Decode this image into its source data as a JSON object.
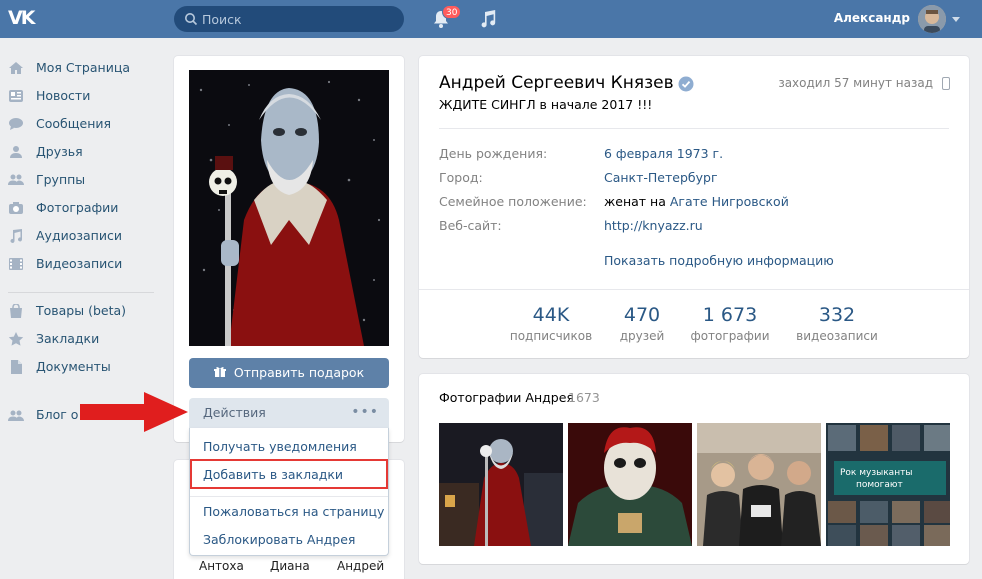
{
  "header": {
    "logo_text": "VK",
    "search_placeholder": "Поиск",
    "notifications_count": "30",
    "user_name": "Александр",
    "accent_color": "#4a76a8"
  },
  "sidebar": {
    "items": [
      {
        "label": "Моя Страница",
        "icon": "home-icon"
      },
      {
        "label": "Новости",
        "icon": "news-icon"
      },
      {
        "label": "Сообщения",
        "icon": "messages-icon"
      },
      {
        "label": "Друзья",
        "icon": "friends-icon"
      },
      {
        "label": "Группы",
        "icon": "groups-icon"
      },
      {
        "label": "Фотографии",
        "icon": "camera-icon"
      },
      {
        "label": "Аудиозаписи",
        "icon": "music-icon"
      },
      {
        "label": "Видеозаписи",
        "icon": "video-icon"
      },
      {
        "label": "Товары (beta)",
        "icon": "bag-icon"
      },
      {
        "label": "Закладки",
        "icon": "star-icon"
      },
      {
        "label": "Документы",
        "icon": "document-icon"
      },
      {
        "label": "Блог о",
        "icon": "blog-icon"
      }
    ]
  },
  "profile": {
    "gift_button": "Отправить подарок",
    "actions_button": "Действия",
    "actions_menu": [
      "Получать уведомления",
      "Добавить в закладки",
      "Пожаловаться на страницу",
      "Заблокировать Андрея"
    ],
    "highlighted_item": "Добавить в закладки",
    "friends_names": [
      "Антоха",
      "Диана",
      "Андрей"
    ],
    "name": "Андрей Сергеевич Князев",
    "last_seen": "заходил 57 минут назад",
    "status": "ЖДИТЕ СИНГЛ в начале 2017 !!!",
    "info": {
      "birthday_label": "День рождения:",
      "birthday": "6 февраля 1973 г.",
      "city_label": "Город:",
      "city": "Санкт-Петербург",
      "family_label": "Семейное положение:",
      "family_prefix": "женат на",
      "family_partner": "Агате Нигровской",
      "site_label": "Веб-сайт:",
      "site": "http://knyazz.ru",
      "show_more": "Показать подробную информацию"
    },
    "stats": [
      {
        "num": "44K",
        "cap": "подписчиков"
      },
      {
        "num": "470",
        "cap": "друзей"
      },
      {
        "num": "1 673",
        "cap": "фотографии"
      },
      {
        "num": "332",
        "cap": "видеозаписи"
      }
    ]
  },
  "photos": {
    "title": "Фотографии Андрея",
    "count": "1673"
  }
}
